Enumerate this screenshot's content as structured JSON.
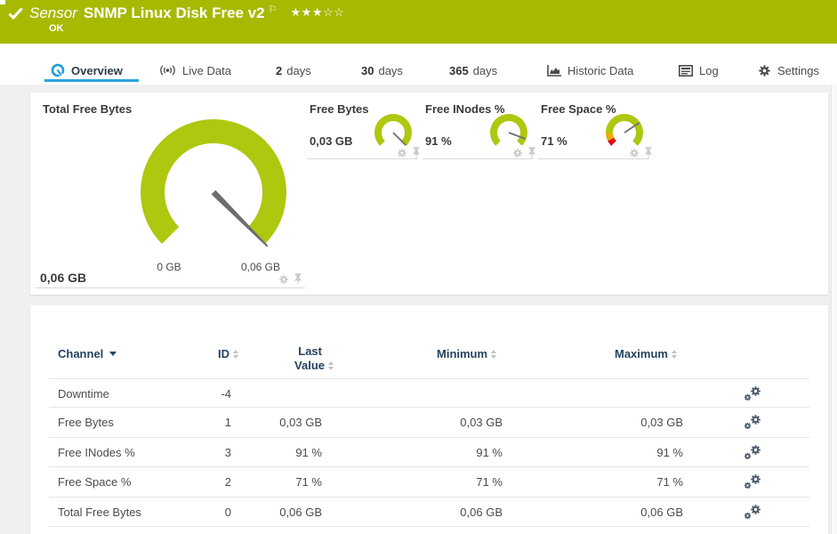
{
  "header": {
    "type_label": "Sensor",
    "title": "SNMP Linux Disk Free v2",
    "status": "OK",
    "rating_filled": "★★★",
    "rating_empty": "☆☆",
    "accent_color": "#a8b902"
  },
  "tabs": {
    "overview": {
      "label": "Overview"
    },
    "live_data": {
      "label": "Live Data"
    },
    "days2": {
      "num": "2",
      "label": "days"
    },
    "days30": {
      "num": "30",
      "label": "days"
    },
    "days365": {
      "num": "365",
      "label": "days"
    },
    "historic": {
      "label": "Historic Data"
    },
    "log": {
      "label": "Log"
    },
    "settings": {
      "label": "Settings"
    }
  },
  "chart_data": [
    {
      "type": "gauge",
      "title": "Total Free Bytes",
      "value": 0.06,
      "min": 0,
      "max": 0.06,
      "value_label": "0,06 GB",
      "min_label": "0 GB",
      "max_label": "0,06 GB",
      "segments": [
        {
          "color": "#aec70f",
          "from": 0,
          "to": 1
        }
      ]
    },
    {
      "type": "gauge",
      "title": "Free Bytes",
      "value": 0.03,
      "min": 0,
      "max": 0.03,
      "value_label": "0,03 GB",
      "segments": [
        {
          "color": "#aec70f",
          "from": 0,
          "to": 1
        }
      ]
    },
    {
      "type": "gauge",
      "title": "Free INodes %",
      "value": 91,
      "min": 0,
      "max": 100,
      "value_label": "91 %",
      "segments": [
        {
          "color": "#aec70f",
          "from": 0,
          "to": 1
        }
      ]
    },
    {
      "type": "gauge",
      "title": "Free Space %",
      "value": 71,
      "min": 0,
      "max": 100,
      "value_label": "71 %",
      "segments": [
        {
          "color": "#dd1111",
          "from": 0,
          "to": 0.07
        },
        {
          "color": "#f0a800",
          "from": 0.07,
          "to": 0.155
        },
        {
          "color": "#aec70f",
          "from": 0.155,
          "to": 1
        }
      ]
    }
  ],
  "table": {
    "headers": {
      "channel": "Channel",
      "id": "ID",
      "last1": "Last",
      "last2": "Value",
      "minimum": "Minimum",
      "maximum": "Maximum"
    },
    "rows": [
      {
        "channel": "Downtime",
        "id": "-4",
        "last": "",
        "min": "",
        "max": ""
      },
      {
        "channel": "Free Bytes",
        "id": "1",
        "last": "0,03 GB",
        "min": "0,03 GB",
        "max": "0,03 GB"
      },
      {
        "channel": "Free INodes %",
        "id": "3",
        "last": "91 %",
        "min": "91 %",
        "max": "91 %"
      },
      {
        "channel": "Free Space %",
        "id": "2",
        "last": "71 %",
        "min": "71 %",
        "max": "71 %"
      },
      {
        "channel": "Total Free Bytes",
        "id": "0",
        "last": "0,06 GB",
        "min": "0,06 GB",
        "max": "0,06 GB"
      }
    ]
  }
}
